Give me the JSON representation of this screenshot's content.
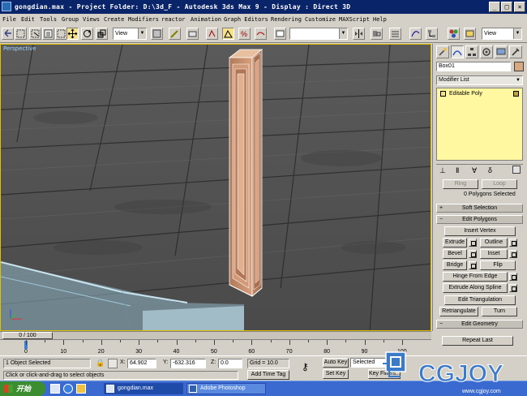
{
  "window": {
    "title": "gongdian.max   - Project Folder: D:\\3d_F   - Autodesk 3ds Max 9   - Display : Direct 3D"
  },
  "menu": [
    "File",
    "Edit",
    "Tools",
    "Group",
    "Views",
    "Create",
    "Modifiers",
    "reactor",
    "Animation",
    "Graph Editors",
    "Rendering",
    "Customize",
    "MAXScript",
    "Help"
  ],
  "toolbar": {
    "ref_coord_system": "View",
    "named_selection": "",
    "view_combo": "View"
  },
  "viewport": {
    "label": "Perspective"
  },
  "command_panel": {
    "object_name": "Box01",
    "object_color": "#d8a880",
    "modifier_list_label": "Modifier List",
    "stack_item": "Editable Poly",
    "ring_label": "Ring",
    "loop_label": "Loop",
    "selection_info": "0 Polygons Selected",
    "rollout_soft_selection": "Soft Selection",
    "rollout_edit_polygons": "Edit Polygons",
    "insert_vertex": "Insert Vertex",
    "extrude": "Extrude",
    "outline": "Outline",
    "bevel": "Bevel",
    "inset": "Inset",
    "bridge": "Bridge",
    "flip": "Flip",
    "hinge_from_edge": "Hinge From Edge",
    "extrude_along_spline": "Extrude Along Spline",
    "edit_triangulation": "Edit Triangulation",
    "retriangulate": "Retriangulate",
    "turn": "Turn",
    "rollout_edit_geometry": "Edit Geometry",
    "repeat_last": "Repeat Last"
  },
  "timeline": {
    "frame_indicator": "0 / 100",
    "ticks": [
      "0",
      "10",
      "20",
      "30",
      "40",
      "50",
      "60",
      "70",
      "80",
      "90",
      "100"
    ]
  },
  "status": {
    "selection_count": "1 Object Selected",
    "prompt": "Click or click-and-drag to select objects",
    "x_label": "X:",
    "x_value": "64.902",
    "y_label": "Y:",
    "y_value": "-632.316",
    "z_label": "Z:",
    "z_value": "0.0",
    "grid": "Grid = 10.0",
    "add_time_tag": "Add Time Tag",
    "auto_key": "Auto Key",
    "selected": "Selected",
    "set_key": "Set Key",
    "key_filters": "Key Filters..."
  },
  "taskbar": {
    "start": "开始",
    "items": [
      "gongdian.max",
      "Adobe Photoshop"
    ]
  },
  "watermark": {
    "brand": "CGJOY",
    "url": "www.cgjoy.com"
  }
}
